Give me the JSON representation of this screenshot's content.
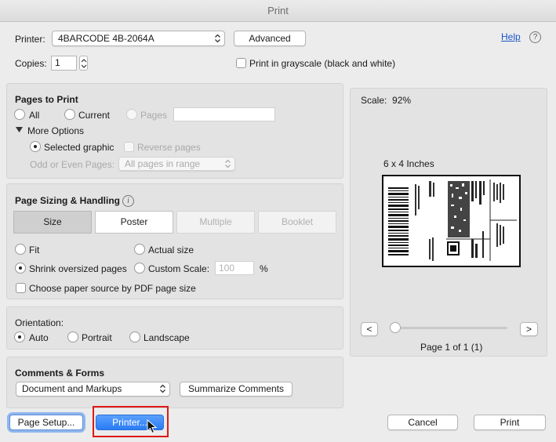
{
  "window": {
    "title": "Print"
  },
  "printer": {
    "label": "Printer:",
    "value": "4BARCODE 4B-2064A",
    "advanced_label": "Advanced",
    "help_label": "Help",
    "help_icon": "?"
  },
  "copies": {
    "label": "Copies:",
    "value": "1"
  },
  "grayscale": {
    "label": "Print in grayscale (black and white)",
    "checked": false
  },
  "pages_to_print": {
    "title": "Pages to Print",
    "all_label": "All",
    "current_label": "Current",
    "pages_label": "Pages",
    "pages_value": "",
    "more_options_label": "More Options",
    "selected_graphic_label": "Selected graphic",
    "reverse_pages_label": "Reverse pages",
    "odd_even_label": "Odd or Even Pages:",
    "odd_even_value": "All pages in range",
    "selected": "all"
  },
  "page_sizing": {
    "title": "Page Sizing & Handling",
    "info_icon": "i",
    "tabs": [
      {
        "label": "Size",
        "state": "selected"
      },
      {
        "label": "Poster",
        "state": "normal"
      },
      {
        "label": "Multiple",
        "state": "disabled"
      },
      {
        "label": "Booklet",
        "state": "disabled"
      }
    ],
    "fit_label": "Fit",
    "actual_size_label": "Actual size",
    "shrink_label": "Shrink oversized pages",
    "custom_scale_label": "Custom Scale:",
    "custom_scale_value": "100",
    "percent_label": "%",
    "paper_source_label": "Choose paper source by PDF page size",
    "selected": "shrink"
  },
  "orientation": {
    "label": "Orientation:",
    "auto_label": "Auto",
    "portrait_label": "Portrait",
    "landscape_label": "Landscape",
    "selected": "auto"
  },
  "comments_forms": {
    "title": "Comments & Forms",
    "value": "Document and Markups",
    "summarize_label": "Summarize Comments"
  },
  "preview": {
    "scale_label": "Scale:",
    "scale_value": "92%",
    "paper_size_label": "6 x 4 Inches",
    "prev_label": "<",
    "next_label": ">",
    "page_indicator": "Page 1 of 1 (1)",
    "slider_position": 0
  },
  "footer": {
    "page_setup_label": "Page Setup...",
    "printer_label": "Printer...",
    "cancel_label": "Cancel",
    "print_label": "Print"
  },
  "colors": {
    "accent": "#2a7cf6",
    "link": "#1a55c8",
    "highlight_box": "#e01818"
  }
}
